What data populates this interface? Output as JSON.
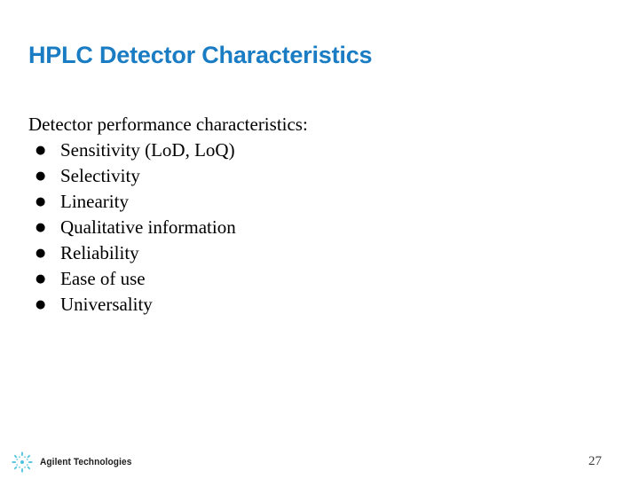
{
  "slide": {
    "title": "HPLC Detector Characteristics",
    "lead_line": "Detector performance characteristics:",
    "bullet_char": "●",
    "bullets": [
      {
        "label": "Sensitivity (LoD, LoQ)"
      },
      {
        "label": "Selectivity"
      },
      {
        "label": "Linearity"
      },
      {
        "label": "Qualitative information"
      },
      {
        "label": "Reliability"
      },
      {
        "label": "Ease of use"
      },
      {
        "label": "Universality"
      }
    ]
  },
  "footer": {
    "brand_name": "Agilent Technologies",
    "brand_icon": "agilent-starburst-icon",
    "page_number": "27"
  },
  "colors": {
    "title_blue": "#1a7cc2",
    "body_text": "#000000",
    "brand_text": "#1d1d1d",
    "brand_mark": "#4ec3dd",
    "page_number": "#3b3b3b",
    "background": "#ffffff"
  }
}
